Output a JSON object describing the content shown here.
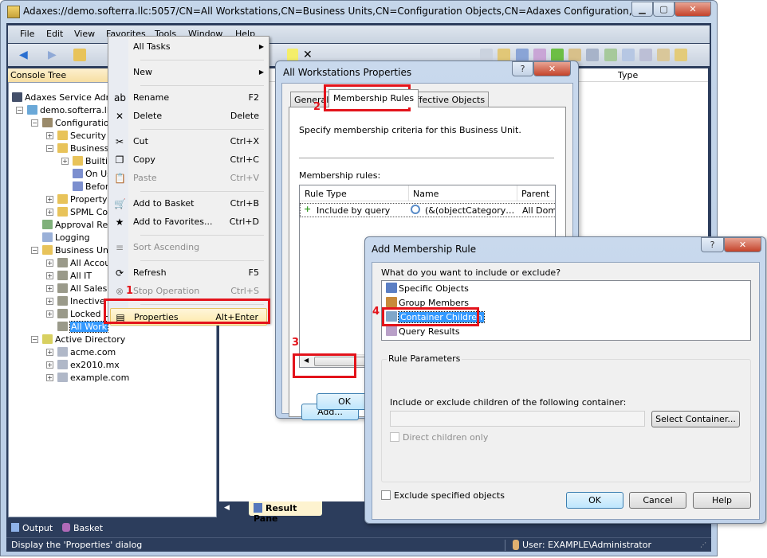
{
  "window": {
    "title": "Adaxes://demo.softerra.llc:5057/CN=All Workstations,CN=Business Units,CN=Configuration Objects,CN=Adaxes Configuration,CN=Adaxes -...",
    "controls": {
      "minimize": "▁",
      "maximize": "▢",
      "close": "✕"
    }
  },
  "menubar": [
    "File",
    "Edit",
    "View",
    "Favorites",
    "Tools",
    "Window",
    "Help"
  ],
  "console_tree": {
    "header": "Console Tree",
    "nodes": [
      {
        "label": "Adaxes Service Admin",
        "level": 0,
        "icon": "adaxes-logo-icon",
        "expander": ""
      },
      {
        "label": "demo.softerra.llc",
        "level": 1,
        "icon": "server-icon",
        "expander": "−"
      },
      {
        "label": "Configuration",
        "level": 2,
        "icon": "tools-icon",
        "expander": "−"
      },
      {
        "label": "Security",
        "level": 3,
        "icon": "folder-key-icon",
        "expander": "+"
      },
      {
        "label": "Business",
        "level": 3,
        "icon": "folder-gear-icon",
        "expander": "−"
      },
      {
        "label": "Builtin",
        "level": 4,
        "icon": "folder-gear-icon",
        "expander": "+"
      },
      {
        "label": "On Us",
        "level": 4,
        "icon": "script-gear-icon",
        "expander": ""
      },
      {
        "label": "Befor",
        "level": 4,
        "icon": "script-gear-icon",
        "expander": ""
      },
      {
        "label": "Property",
        "level": 3,
        "icon": "folder-property-icon",
        "expander": "+"
      },
      {
        "label": "SPML Con",
        "level": 3,
        "icon": "folder-plug-icon",
        "expander": "+"
      },
      {
        "label": "Approval Req",
        "level": 2,
        "icon": "approval-icon",
        "expander": ""
      },
      {
        "label": "Logging",
        "level": 2,
        "icon": "log-icon",
        "expander": ""
      },
      {
        "label": "Business Units",
        "level": 2,
        "icon": "folder-units-icon",
        "expander": "−"
      },
      {
        "label": "All Accoun",
        "level": 3,
        "icon": "business-unit-icon",
        "expander": "+"
      },
      {
        "label": "All IT",
        "level": 3,
        "icon": "business-unit-icon",
        "expander": "+"
      },
      {
        "label": "All Sales",
        "level": 3,
        "icon": "business-unit-icon",
        "expander": "+"
      },
      {
        "label": "Inective a",
        "level": 3,
        "icon": "business-unit-icon",
        "expander": "+"
      },
      {
        "label": "Locked U",
        "level": 3,
        "icon": "business-unit-icon",
        "expander": "+"
      },
      {
        "label": "All Work",
        "level": 3,
        "icon": "business-unit-icon",
        "expander": "",
        "selected": true
      },
      {
        "label": "Active Directory",
        "level": 2,
        "icon": "active-directory-icon",
        "expander": "−"
      },
      {
        "label": "acme.com",
        "level": 3,
        "icon": "domain-icon",
        "expander": "+"
      },
      {
        "label": "ex2010.mx",
        "level": 3,
        "icon": "domain-icon",
        "expander": "+"
      },
      {
        "label": "example.com",
        "level": 3,
        "icon": "domain-icon",
        "expander": "+"
      }
    ]
  },
  "result_pane": {
    "column_type": "Type",
    "tab_label": "Result Pane"
  },
  "context_menu": {
    "items": [
      {
        "label": "All Tasks",
        "shortcut": "",
        "submenu": true,
        "icon": "",
        "disabled": false
      },
      {
        "sep": true
      },
      {
        "label": "New",
        "shortcut": "",
        "submenu": true,
        "icon": "",
        "disabled": false
      },
      {
        "sep": true
      },
      {
        "label": "Rename",
        "shortcut": "F2",
        "icon": "rename-icon",
        "glyph": "ab",
        "disabled": false
      },
      {
        "label": "Delete",
        "shortcut": "Delete",
        "icon": "delete-icon",
        "glyph": "✕",
        "disabled": false
      },
      {
        "sep": true
      },
      {
        "label": "Cut",
        "shortcut": "Ctrl+X",
        "icon": "cut-icon",
        "glyph": "✂",
        "disabled": false
      },
      {
        "label": "Copy",
        "shortcut": "Ctrl+C",
        "icon": "copy-icon",
        "glyph": "❐",
        "disabled": false
      },
      {
        "label": "Paste",
        "shortcut": "Ctrl+V",
        "icon": "paste-icon",
        "glyph": "📋",
        "disabled": true
      },
      {
        "sep": true
      },
      {
        "label": "Add to Basket",
        "shortcut": "Ctrl+B",
        "icon": "basket-icon",
        "glyph": "🛒",
        "disabled": false
      },
      {
        "label": "Add to Favorites...",
        "shortcut": "Ctrl+D",
        "icon": "favorites-icon",
        "glyph": "★",
        "disabled": false
      },
      {
        "sep": true
      },
      {
        "label": "Sort Ascending",
        "shortcut": "",
        "icon": "sort-ascending-icon",
        "glyph": "≡",
        "disabled": true
      },
      {
        "sep": true
      },
      {
        "label": "Refresh",
        "shortcut": "F5",
        "icon": "refresh-icon",
        "glyph": "⟳",
        "disabled": false
      },
      {
        "label": "Stop Operation",
        "shortcut": "Ctrl+S",
        "icon": "stop-icon",
        "glyph": "⊗",
        "disabled": true
      },
      {
        "sep": true
      },
      {
        "label": "Properties",
        "shortcut": "Alt+Enter",
        "icon": "properties-icon",
        "glyph": "▤",
        "disabled": false,
        "highlighted": true
      }
    ]
  },
  "properties_dialog": {
    "title": "All Workstations Properties",
    "help": "?",
    "close": "✕",
    "tabs": [
      "General",
      "Membership Rules",
      "Effective Objects"
    ],
    "active_tab": "Membership Rules",
    "description": "Specify membership criteria for this Business Unit.",
    "rules_label": "Membership rules:",
    "columns": [
      "Rule Type",
      "Name",
      "Parent"
    ],
    "rows": [
      {
        "rule_type": "Include by query",
        "name": "(&(objectCategory…",
        "parent": "All Domai"
      }
    ],
    "add_button": "Add...",
    "ok_button": "OK"
  },
  "add_rule_dialog": {
    "title": "Add Membership Rule",
    "help": "?",
    "close": "✕",
    "question": "What do you want to include or exclude?",
    "options": [
      {
        "label": "Specific Objects",
        "icon": "specific-objects-icon",
        "color": "#5b7fc4"
      },
      {
        "label": "Group Members",
        "icon": "group-members-icon",
        "color": "#c88a3a"
      },
      {
        "label": "Container Children",
        "icon": "container-children-icon",
        "color": "#7fa6c9",
        "selected": true
      },
      {
        "label": "Query Results",
        "icon": "query-results-icon",
        "color": "#b9a0c8"
      }
    ],
    "rule_parameters_label": "Rule Parameters",
    "container_label": "Include or exclude children of the following container:",
    "container_value": "",
    "select_container_button": "Select Container...",
    "direct_children_label": "Direct children only",
    "direct_children_checked": false,
    "exclude_label": "Exclude specified objects",
    "exclude_checked": false,
    "ok_button": "OK",
    "cancel_button": "Cancel",
    "help_button": "Help"
  },
  "annotations": [
    "1",
    "2",
    "3",
    "4"
  ],
  "bottom_panes": {
    "output": "Output",
    "basket": "Basket"
  },
  "status_bar": {
    "message": "Display the 'Properties' dialog",
    "user": "User: EXAMPLE\\Administrator"
  },
  "colors": {
    "highlight_red": "#e3131b",
    "selection_blue": "#3399ff",
    "frame_navy": "#2c3d5c"
  }
}
